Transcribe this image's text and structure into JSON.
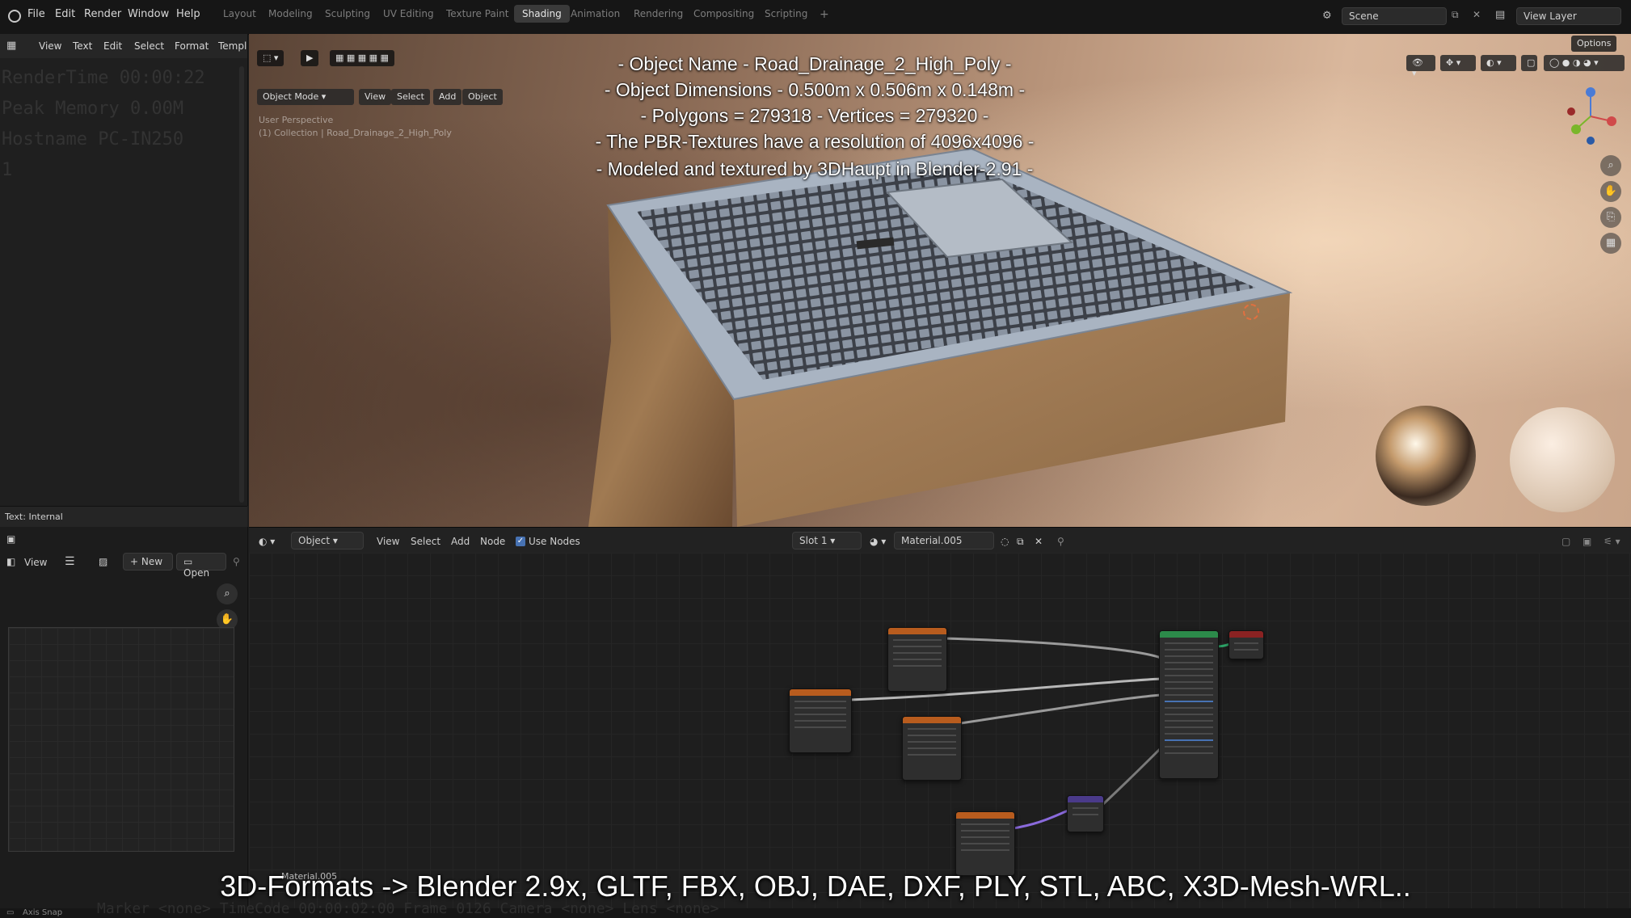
{
  "top_bar": {
    "menus": [
      "File",
      "Edit",
      "Render",
      "Window",
      "Help"
    ],
    "workspaces": [
      "Layout",
      "Modeling",
      "Sculpting",
      "UV Editing",
      "Texture Paint",
      "Shading",
      "Animation",
      "Rendering",
      "Compositing",
      "Scripting"
    ],
    "active_workspace": "Shading",
    "add_workspace": "+",
    "scene_label": "Scene",
    "view_layer_label": "View Layer"
  },
  "text_editor": {
    "menus": [
      "View",
      "Text",
      "Edit",
      "Select",
      "Format",
      "Templ"
    ],
    "ghost_lines": [
      "RenderTime 00:00:22",
      "Peak Memory 0.00M",
      "Hostname PC-IN250",
      "1"
    ],
    "status": "Text: Internal"
  },
  "image_editor": {
    "view_label": "View",
    "new_label": "New",
    "open_label": "Open"
  },
  "viewport": {
    "mode": "Object Mode",
    "menus": [
      "View",
      "Select",
      "Add",
      "Object"
    ],
    "options_label": "Options",
    "persp_label": "User Perspective",
    "collection_label": "(1) Collection | Road_Drainage_2_High_Poly",
    "overlay_lines": [
      "- Object Name - Road_Drainage_2_High_Poly -",
      "- Object Dimensions -  0.500m x 0.506m x 0.148m -",
      "- Polygons = 279318  -  Vertices = 279320 -",
      "- The PBR-Textures have a resolution of 4096x4096 -",
      "- Modeled and textured by 3DHaupt in Blender-2.91 -"
    ]
  },
  "node_editor": {
    "object_label": "Object",
    "menus": [
      "View",
      "Select",
      "Add",
      "Node"
    ],
    "use_nodes_label": "Use Nodes",
    "slot_label": "Slot 1",
    "material_label": "Material.005",
    "corner_material": "Material.005"
  },
  "bottom_caption": "3D-Formats -> Blender 2.9x, GLTF, FBX, OBJ, DAE, DXF, PLY, STL, ABC, X3D-Mesh-WRL..",
  "status_bar": {
    "left": "Axis Snap",
    "ghost": "Marker <none>   TimeCode 00:00:02:00   Frame 0126   Camera <none>   Lens <none>"
  },
  "colors": {
    "accent": "#4772b3",
    "node_header_texture": "#b85c1e",
    "node_header_shader": "#2c8a4a",
    "node_header_output": "#8a2222",
    "node_header_vector": "#4a3a8a"
  }
}
